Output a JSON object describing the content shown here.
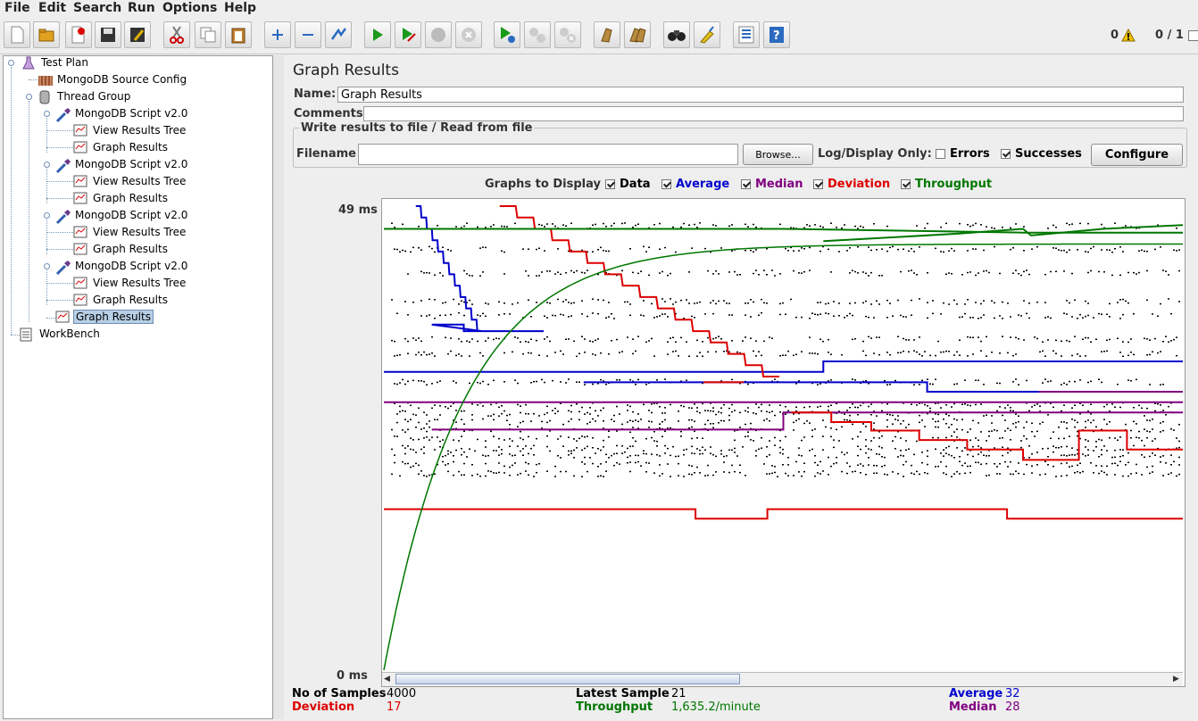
{
  "menu": {
    "file": "File",
    "edit": "Edit",
    "search": "Search",
    "run": "Run",
    "options": "Options",
    "help": "Help"
  },
  "status": {
    "warnings": "0",
    "threads": "0 / 1"
  },
  "tree": {
    "test_plan": "Test Plan",
    "mongo_config": "MongoDB Source Config",
    "thread_group": "Thread Group",
    "script": "MongoDB Script v2.0",
    "view_tree": "View Results Tree",
    "graph": "Graph Results",
    "workbench": "WorkBench"
  },
  "panel": {
    "title": "Graph Results",
    "name_label": "Name:",
    "name_value": "Graph Results",
    "comments_label": "Comments:",
    "comments_value": "",
    "file_group_title": "Write results to file / Read from file",
    "filename_label": "Filename",
    "filename_value": "",
    "browse_label": "Browse...",
    "log_display_label": "Log/Display Only:",
    "errors_label": "Errors",
    "successes_label": "Successes",
    "configure_label": "Configure"
  },
  "graphs_to_display": {
    "label": "Graphs to Display",
    "data": "Data",
    "average": "Average",
    "median": "Median",
    "deviation": "Deviation",
    "throughput": "Throughput"
  },
  "chart_data": {
    "type": "line",
    "y_max_label": "49  ms",
    "y_min_label": "0  ms",
    "ylim": [
      0,
      49
    ],
    "series": [
      {
        "name": "Data",
        "color": "#000000"
      },
      {
        "name": "Average",
        "color": "#0000cc",
        "final": 32
      },
      {
        "name": "Median",
        "color": "#800080",
        "final": 28
      },
      {
        "name": "Deviation",
        "color": "#dd0000",
        "final": 17
      },
      {
        "name": "Throughput",
        "color": "#007700"
      }
    ]
  },
  "summary": {
    "samples_label": "No of Samples",
    "samples_value": "4000",
    "deviation_label": "Deviation",
    "deviation_value": "17",
    "latest_label": "Latest Sample",
    "latest_value": "21",
    "throughput_label": "Throughput",
    "throughput_value": "1,635.2/minute",
    "average_label": "Average",
    "average_value": "32",
    "median_label": "Median",
    "median_value": "28"
  },
  "colors": {
    "average": "#0000cc",
    "median": "#800080",
    "deviation": "#dd0000",
    "throughput": "#007700"
  }
}
